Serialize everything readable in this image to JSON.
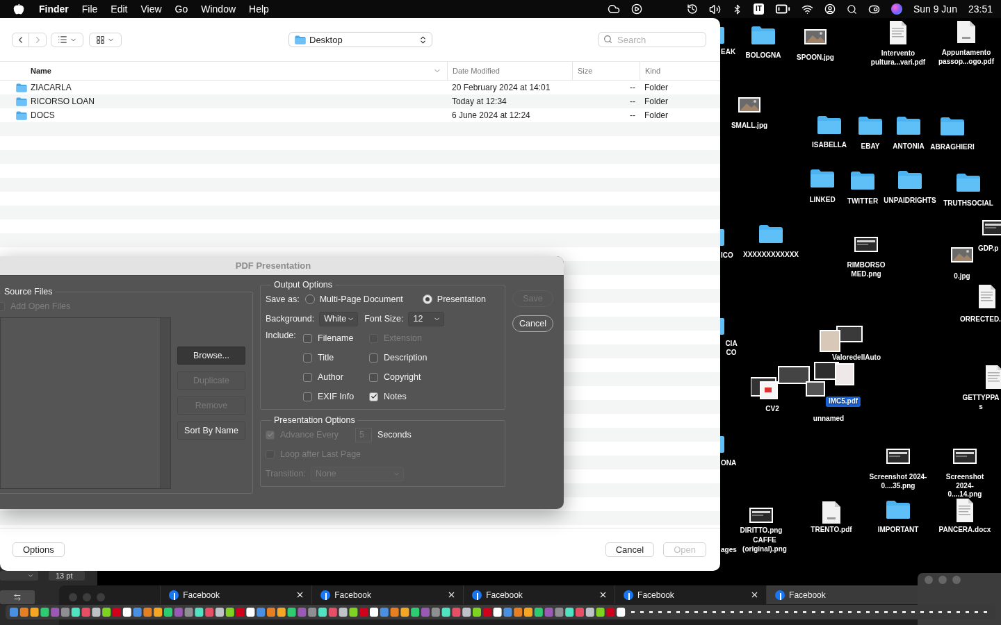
{
  "menu_bar": {
    "app": "Finder",
    "menus": [
      "File",
      "Edit",
      "View",
      "Go",
      "Window",
      "Help"
    ],
    "input_source": "IT",
    "date": "Sun 9 Jun",
    "time": "23:51"
  },
  "finder": {
    "location": "Desktop",
    "search": {
      "placeholder": "Search"
    },
    "columns": [
      "Name",
      "Date Modified",
      "Size",
      "Kind"
    ],
    "rows": [
      {
        "name": "ZIACARLA",
        "date": "20 February 2024 at 14:01",
        "size": "--",
        "kind": "Folder"
      },
      {
        "name": "RICORSO LOAN",
        "date": "Today at 12:34",
        "size": "--",
        "kind": "Folder"
      },
      {
        "name": "DOCS",
        "date": "6 June 2024 at 12:24",
        "size": "--",
        "kind": "Folder"
      }
    ],
    "options_button": "Options",
    "cancel_button": "Cancel",
    "open_button": {
      "label": "Open",
      "disabled": true
    }
  },
  "pdf_dialog": {
    "title": "PDF Presentation",
    "source_files": {
      "title": "Source Files",
      "add_open_files": {
        "label": "Add Open Files",
        "checked": false,
        "disabled": true
      },
      "buttons": [
        {
          "label": "Browse...",
          "default": true,
          "disabled": false
        },
        {
          "label": "Duplicate",
          "default": false,
          "disabled": true
        },
        {
          "label": "Remove",
          "default": false,
          "disabled": true
        },
        {
          "label": "Sort By Name",
          "default": false,
          "disabled": false
        }
      ]
    },
    "output_options": {
      "title": "Output Options",
      "save_as_label": "Save as:",
      "save_as": [
        {
          "label": "Multi-Page Document",
          "selected": false
        },
        {
          "label": "Presentation",
          "selected": true
        }
      ],
      "background_label": "Background:",
      "background": "White",
      "font_size_label": "Font Size:",
      "font_size": "12",
      "include_label": "Include:",
      "include": [
        {
          "label": "Filename",
          "checked": false,
          "disabled": false
        },
        {
          "label": "Extension",
          "checked": false,
          "disabled": true
        },
        {
          "label": "Title",
          "checked": false,
          "disabled": false
        },
        {
          "label": "Description",
          "checked": false,
          "disabled": false
        },
        {
          "label": "Author",
          "checked": false,
          "disabled": false
        },
        {
          "label": "Copyright",
          "checked": false,
          "disabled": false
        },
        {
          "label": "EXIF Info",
          "checked": false,
          "disabled": false
        },
        {
          "label": "Notes",
          "checked": true,
          "disabled": false
        }
      ]
    },
    "presentation_options": {
      "title": "Presentation Options",
      "advance_every": {
        "label": "Advance Every",
        "checked": true,
        "disabled": true
      },
      "seconds": {
        "value": "5",
        "disabled": true
      },
      "seconds_label": "Seconds",
      "loop": {
        "label": "Loop after Last Page",
        "checked": false,
        "disabled": true
      },
      "transition": {
        "label": "Transition:",
        "value": "None",
        "disabled": true
      }
    },
    "actions": [
      {
        "label": "Save",
        "disabled": true
      },
      {
        "label": "Cancel",
        "disabled": false
      }
    ]
  },
  "desktop_icons": [
    {
      "label": "EAK",
      "kind": "folder",
      "selected": false
    },
    {
      "label": "BOLOGNA",
      "kind": "folder",
      "selected": false
    },
    {
      "label": "SPOON.jpg",
      "kind": "image",
      "selected": false
    },
    {
      "label": "Intervento pultura...vari.pdf",
      "kind": "doc",
      "selected": false
    },
    {
      "label": "Appuntamento passop...ogo.pdf",
      "kind": "pdf",
      "selected": false
    },
    {
      "label": "SMALL.jpg",
      "kind": "image",
      "selected": false
    },
    {
      "label": "ISABELLA",
      "kind": "folder",
      "selected": false
    },
    {
      "label": "EBAY",
      "kind": "folder",
      "selected": false
    },
    {
      "label": "ANTONIA",
      "kind": "folder",
      "selected": false
    },
    {
      "label": "ABRAGHIERI",
      "kind": "folder",
      "selected": false
    },
    {
      "label": "LINKED",
      "kind": "folder",
      "selected": false
    },
    {
      "label": "TWITTER",
      "kind": "folder",
      "selected": false
    },
    {
      "label": "UNPAIDRIGHTS",
      "kind": "folder",
      "selected": false
    },
    {
      "label": "TRUTHSOCIAL",
      "kind": "folder",
      "selected": false
    },
    {
      "label": "ICO",
      "kind": "folder",
      "selected": false
    },
    {
      "label": "XXXXXXXXXXXX",
      "kind": "folder",
      "selected": false
    },
    {
      "label": "RIMBORSO MED.png",
      "kind": "screenshot",
      "selected": false
    },
    {
      "label": "GDP.p",
      "kind": "screenshot",
      "selected": false
    },
    {
      "label": "0.jpg",
      "kind": "image",
      "selected": false
    },
    {
      "label": "ORRECTED.",
      "kind": "doc",
      "selected": false
    },
    {
      "label": "CIA CO",
      "kind": "folder",
      "selected": false
    },
    {
      "label": "GETTYPPA s",
      "kind": "doc",
      "selected": false
    },
    {
      "label": "ValoredellAuto",
      "kind": "stacked",
      "selected": false
    },
    {
      "label": "IMC5.pdf",
      "kind": "stacked",
      "selected": true
    },
    {
      "label": "CV2",
      "kind": "stacked",
      "selected": false
    },
    {
      "label": "unnamed",
      "kind": "stacked",
      "selected": false
    },
    {
      "label": "ONA",
      "kind": "folder",
      "selected": false
    },
    {
      "label": "Screenshot 2024-0....35.png",
      "kind": "screenshot",
      "selected": false
    },
    {
      "label": "Screenshot 2024-0....14.png",
      "kind": "screenshot",
      "selected": false
    },
    {
      "label": "DIRITTO.png",
      "kind": "screenshot",
      "selected": false
    },
    {
      "label": "ages",
      "kind": "stacked",
      "selected": false
    },
    {
      "label": "CAFFE (original).png",
      "kind": "stacked",
      "selected": false
    },
    {
      "label": "TRENTO.pdf",
      "kind": "pdf",
      "selected": false
    },
    {
      "label": "IMPORTANT",
      "kind": "folder",
      "selected": false
    },
    {
      "label": "PANCERA.docx",
      "kind": "doc",
      "selected": false
    }
  ],
  "font_size_field": "13 pt",
  "browser_tabs": [
    {
      "title": "Facebook",
      "selected": false
    },
    {
      "title": "Facebook",
      "selected": false
    },
    {
      "title": "Facebook",
      "selected": false
    },
    {
      "title": "Facebook",
      "selected": false
    },
    {
      "title": "Facebook",
      "selected": true
    }
  ]
}
